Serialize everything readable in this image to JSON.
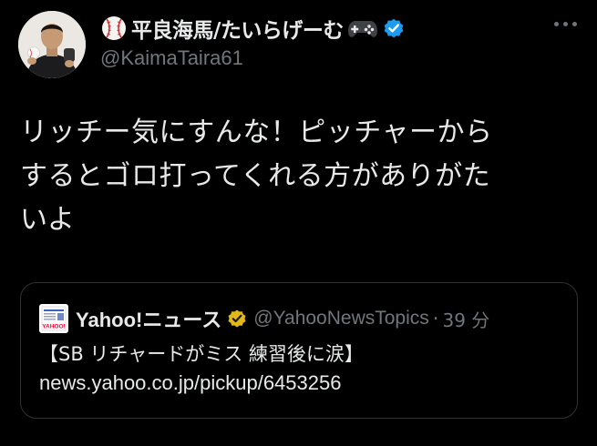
{
  "author": {
    "display_name": "平良海馬/たいらげーむ",
    "handle": "@KaimaTaira61",
    "name_prefix_icon": "baseball-icon",
    "name_suffix_icon": "game-controller-icon",
    "verified_badge": "verified-badge-icon",
    "verified_color": "#1d9bf0"
  },
  "tweet": {
    "text_lines": [
      "リッチー気にすんな！ピッチャーから",
      "するとゴロ打ってくれる方がありがた",
      "いよ"
    ]
  },
  "quoted_tweet": {
    "logo": "yahoo-news-logo",
    "logo_text": "YAHOO!",
    "name": "Yahoo!ニュース",
    "badge": "gold-verified-badge-icon",
    "badge_color": "#e2b719",
    "handle": "@YahooNewsTopics",
    "separator": "·",
    "time": "39 分",
    "headline": "【SB リチャードがミス 練習後に涙】",
    "link": "news.yahoo.co.jp/pickup/6453256"
  },
  "colors": {
    "background": "#000000",
    "text": "#e7e9ea",
    "secondary_text": "#71767b",
    "border": "#2f3336"
  }
}
